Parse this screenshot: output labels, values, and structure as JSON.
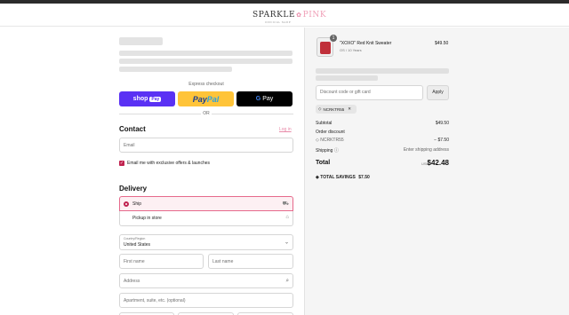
{
  "brand": {
    "logo_a": "SPARKLE",
    "logo_flower": "✿",
    "logo_b": "PINK",
    "tagline": "OFFICIAL SHOP"
  },
  "express": {
    "label": "Express checkout",
    "shop_pay": {
      "text": "shop",
      "pill": "Pay"
    },
    "paypal": {
      "pay": "Pay",
      "pal": "Pal"
    },
    "gpay": {
      "g": "G",
      "text": "Pay"
    },
    "or": "OR"
  },
  "contact": {
    "heading": "Contact",
    "login": "Log in",
    "email_placeholder": "Email",
    "newsletter_label": "Email me with exclusive offers & launches",
    "newsletter_checked": true
  },
  "delivery": {
    "heading": "Delivery",
    "options": [
      {
        "label": "Ship",
        "selected": true,
        "icon": "truck-icon"
      },
      {
        "label": "Pickup in store",
        "selected": false,
        "icon": "store-icon"
      }
    ],
    "country_label": "Country/Region",
    "country_value": "United States",
    "first_name": "First name",
    "last_name": "Last name",
    "address": "Address",
    "apartment": "Apartment, suite, etc. (optional)"
  },
  "order": {
    "quantity": "1",
    "product_name": "\"XOXO\" Red Knit Sweater",
    "product_variant": "OS / 10 Years",
    "product_price": "$49.50",
    "discount_placeholder": "Discount code or gift card",
    "apply_label": "Apply",
    "applied_code": "NCRKTR55",
    "subtotal_label": "Subtotal",
    "subtotal_value": "$49.50",
    "order_discount_label": "Order discount",
    "order_discount_code": "NCRKTR55",
    "order_discount_value": "− $7.50",
    "shipping_label": "Shipping",
    "shipping_value": "Enter shipping address",
    "total_label": "Total",
    "total_currency": "USD",
    "total_value": "$42.48",
    "savings_label": "TOTAL SAVINGS",
    "savings_value": "$7.50"
  },
  "colors": {
    "accent": "#c0224f",
    "shop_pay": "#5a31f4",
    "paypal": "#ffc439",
    "link": "#e88aa8"
  }
}
